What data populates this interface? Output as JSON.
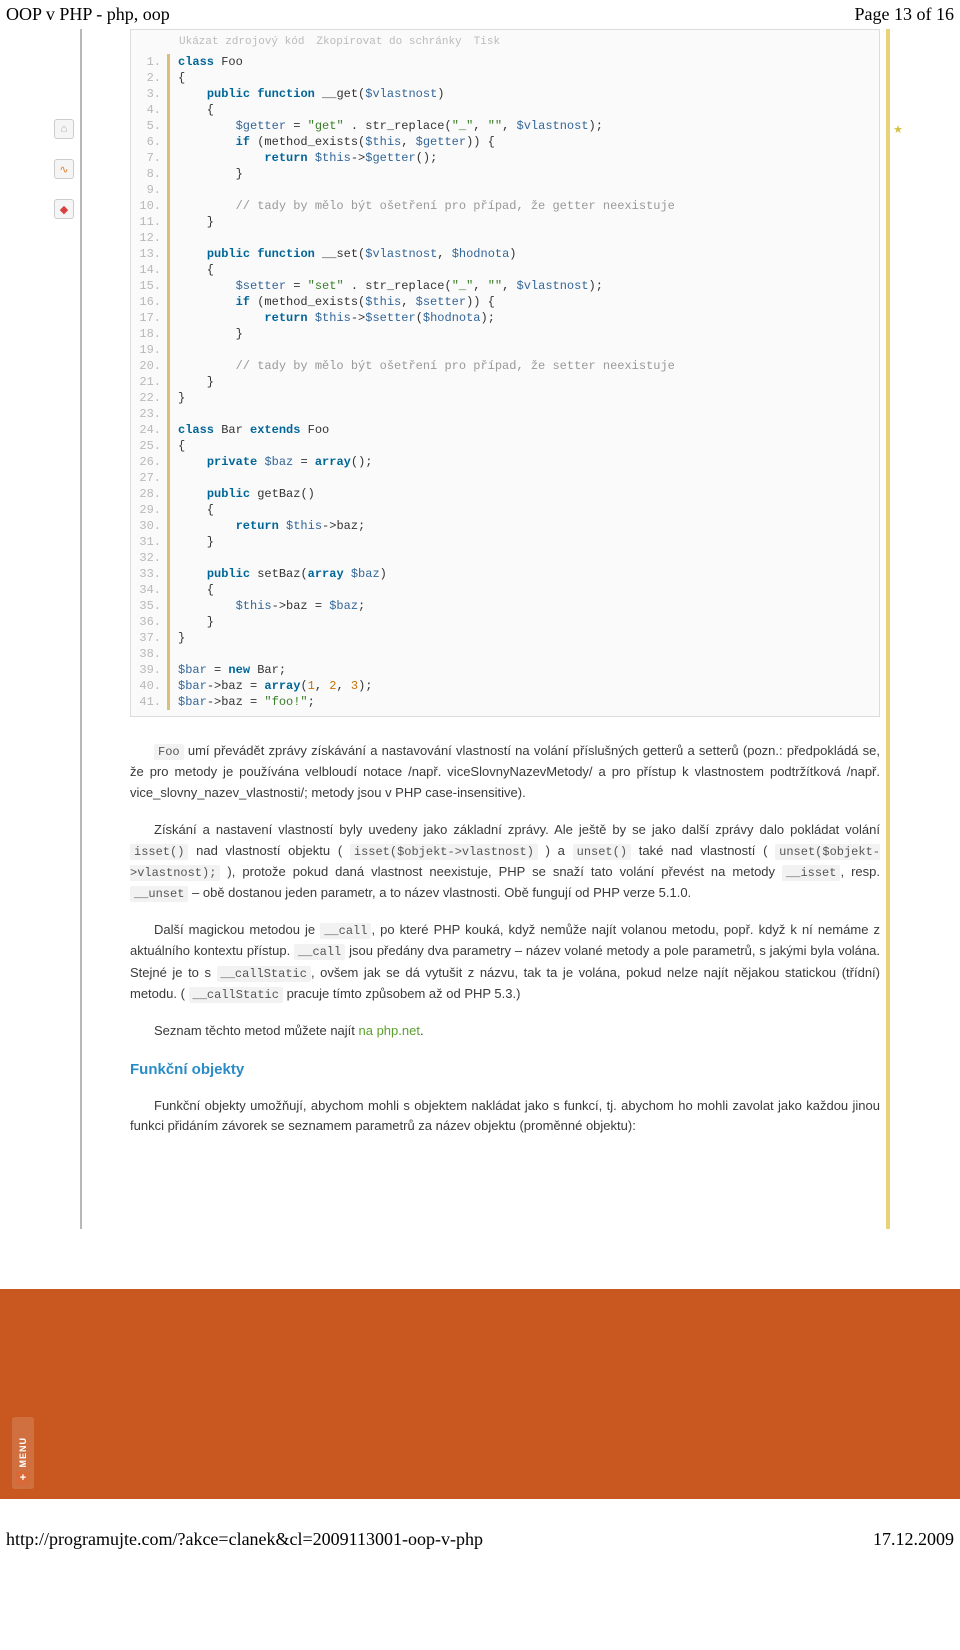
{
  "header": {
    "title_left": "OOP v PHP - php, oop",
    "title_right": "Page 13 of 16"
  },
  "toolbar": {
    "show_source": "Ukázat zdrojový kód",
    "copy_clipboard": "Zkopírovat do schránky",
    "print": "Tisk"
  },
  "code": [
    {
      "n": "1.",
      "h": "<span class='kw'>class</span> Foo"
    },
    {
      "n": "2.",
      "h": "{"
    },
    {
      "n": "3.",
      "h": "    <span class='kw'>public</span> <span class='kw'>function</span> __get(<span class='var'>$vlastnost</span>)"
    },
    {
      "n": "4.",
      "h": "    {"
    },
    {
      "n": "5.",
      "h": "        <span class='var'>$getter</span> = <span class='str'>\"get\"</span> . str_replace(<span class='str'>\"_\"</span>, <span class='str'>\"\"</span>, <span class='var'>$vlastnost</span>);"
    },
    {
      "n": "6.",
      "h": "        <span class='kw'>if</span> (method_exists(<span class='var'>$this</span>, <span class='var'>$getter</span>)) {"
    },
    {
      "n": "7.",
      "h": "            <span class='kw'>return</span> <span class='var'>$this</span>-><span class='var'>$getter</span>();"
    },
    {
      "n": "8.",
      "h": "        }"
    },
    {
      "n": "9.",
      "h": ""
    },
    {
      "n": "10.",
      "h": "        <span class='cmt'>// tady by mělo být ošetření pro případ, že getter neexistuje</span>"
    },
    {
      "n": "11.",
      "h": "    }"
    },
    {
      "n": "12.",
      "h": ""
    },
    {
      "n": "13.",
      "h": "    <span class='kw'>public</span> <span class='kw'>function</span> __set(<span class='var'>$vlastnost</span>, <span class='var'>$hodnota</span>)"
    },
    {
      "n": "14.",
      "h": "    {"
    },
    {
      "n": "15.",
      "h": "        <span class='var'>$setter</span> = <span class='str'>\"set\"</span> . str_replace(<span class='str'>\"_\"</span>, <span class='str'>\"\"</span>, <span class='var'>$vlastnost</span>);"
    },
    {
      "n": "16.",
      "h": "        <span class='kw'>if</span> (method_exists(<span class='var'>$this</span>, <span class='var'>$setter</span>)) {"
    },
    {
      "n": "17.",
      "h": "            <span class='kw'>return</span> <span class='var'>$this</span>-><span class='var'>$setter</span>(<span class='var'>$hodnota</span>);"
    },
    {
      "n": "18.",
      "h": "        }"
    },
    {
      "n": "19.",
      "h": ""
    },
    {
      "n": "20.",
      "h": "        <span class='cmt'>// tady by mělo být ošetření pro případ, že setter neexistuje</span>"
    },
    {
      "n": "21.",
      "h": "    }"
    },
    {
      "n": "22.",
      "h": "}"
    },
    {
      "n": "23.",
      "h": ""
    },
    {
      "n": "24.",
      "h": "<span class='kw'>class</span> Bar <span class='kw'>extends</span> Foo"
    },
    {
      "n": "25.",
      "h": "{"
    },
    {
      "n": "26.",
      "h": "    <span class='kw'>private</span> <span class='var'>$baz</span> = <span class='kw'>array</span>();"
    },
    {
      "n": "27.",
      "h": ""
    },
    {
      "n": "28.",
      "h": "    <span class='kw'>public</span> getBaz()"
    },
    {
      "n": "29.",
      "h": "    {"
    },
    {
      "n": "30.",
      "h": "        <span class='kw'>return</span> <span class='var'>$this</span>->baz;"
    },
    {
      "n": "31.",
      "h": "    }"
    },
    {
      "n": "32.",
      "h": ""
    },
    {
      "n": "33.",
      "h": "    <span class='kw'>public</span> setBaz(<span class='kw'>array</span> <span class='var'>$baz</span>)"
    },
    {
      "n": "34.",
      "h": "    {"
    },
    {
      "n": "35.",
      "h": "        <span class='var'>$this</span>->baz = <span class='var'>$baz</span>;"
    },
    {
      "n": "36.",
      "h": "    }"
    },
    {
      "n": "37.",
      "h": "}"
    },
    {
      "n": "38.",
      "h": ""
    },
    {
      "n": "39.",
      "h": "<span class='var'>$bar</span> = <span class='kw'>new</span> Bar;"
    },
    {
      "n": "40.",
      "h": "<span class='var'>$bar</span>->baz = <span class='kw'>array</span>(<span class='lit'>1</span>, <span class='lit'>2</span>, <span class='lit'>3</span>);"
    },
    {
      "n": "41.",
      "h": "<span class='var'>$bar</span>->baz = <span class='str'>\"foo!\"</span>;"
    }
  ],
  "inline": {
    "foo": "Foo",
    "isset_fn": "isset()",
    "isset_expr": "isset($objekt->vlastnost)",
    "unset_fn": "unset()",
    "unset_expr": "unset($objekt->vlastnost);",
    "mm_isset": "__isset",
    "mm_unset": "__unset",
    "mm_call": "__call",
    "mm_callstatic": "__callStatic"
  },
  "prose": {
    "p1a": " umí převádět zprávy získávání a nastavování vlastností na volání příslušných getterů a setterů (pozn.: předpokládá se, že pro metody je používána velbloudí notace /např. viceSlovnyNazevMetody/ a pro přístup k vlastnostem podtržítková /např. vice_slovny_na­zev_vlastnosti/; metody jsou v PHP case-insensitive).",
    "p2a": "Získání a nastavení vlastností byly uvedeny jako základní zprávy. Ale ještě by se jako další zprávy dalo pokládat volání ",
    "p2b": " nad vlastností objektu ( ",
    "p2c": " ) a ",
    "p2d": " také nad vlastností ( ",
    "p2e": " ), protože pokud daná vlastnost neexistuje, PHP se snaží tato volání převést na metody ",
    "p2f": ", resp. ",
    "p2g": " – obě dostanou jeden parametr, a to název vlastnosti. Obě fungují od PHP verze 5.1.0.",
    "p3a": "Další magickou metodou je ",
    "p3b": ", po které PHP kouká, když nemůže najít volanou metodu, popř. když k ní nemáme z aktuálního kontextu přístup. ",
    "p3c": " jsou předány dva parametry – název volané metody a pole parametrů, s jakými byla volána. Stejné je to s ",
    "p3d": ", ovšem jak se dá vytušit z názvu, tak ta je volána, pokud nelze najít nějakou statickou (třídní) metodu. ( ",
    "p3e": " pracuje tímto způsobem až od PHP 5.3.)",
    "p4a": "Seznam těchto metod můžete najít ",
    "p4_link": "na php.net",
    "p4b": ".",
    "h_funkcni": "Funkční objekty",
    "p5": "Funkční objekty umožňují, abychom mohli s objektem nakládat jako s funkcí, tj. abychom ho mohli zavolat jako každou jinou funkci přidáním závorek se seznamem parametrů za název objektu (proměnné objektu):"
  },
  "menu": {
    "label": "MENU"
  },
  "footer": {
    "url": "http://programujte.com/?akce=clanek&cl=2009113001-oop-v-php",
    "date": "17.12.2009"
  }
}
